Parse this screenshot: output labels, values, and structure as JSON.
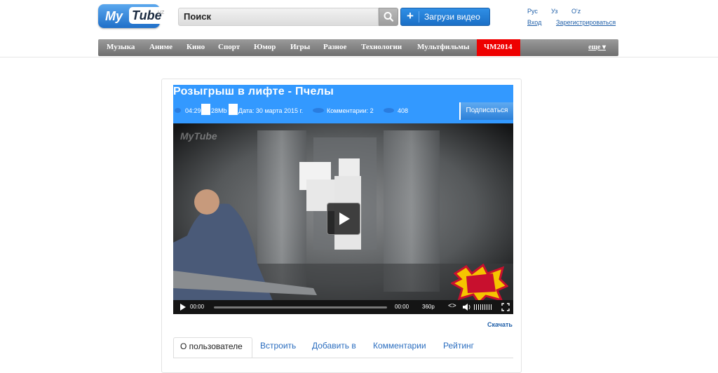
{
  "header": {
    "logo": {
      "my": "My",
      "tube": "Tube",
      "suffix": "UZ"
    },
    "search_value": "Поиск",
    "upload_label": "Загрузи видео",
    "languages": [
      "Рус",
      "Уз",
      "O'z"
    ],
    "login": "Вход",
    "register": "Зарегистрироваться"
  },
  "nav": {
    "items": [
      "Музыка",
      "Аниме",
      "Кино",
      "Спорт",
      "Юмор",
      "Игры",
      "Разное",
      "Технологии",
      "Мультфильмы"
    ],
    "highlight": "ЧМ2014",
    "more": "еще"
  },
  "video": {
    "title": "Розыгрыш в лифте - Пчелы",
    "duration": "04:29",
    "size": "28Mb",
    "date": "Дата: 30 марта 2015 г.",
    "comments": "Комментарии: 2",
    "views": "408",
    "subscribe_label": "Подписаться",
    "watermark": "MyTube",
    "player": {
      "current_time": "00:00",
      "total_time": "00:00",
      "quality": "360p"
    },
    "download_label": "Скачать"
  },
  "tabs": [
    "О пользователе",
    "Встроить",
    "Добавить в",
    "Комментарии",
    "Рейтинг"
  ],
  "colors": {
    "accent": "#3399ff",
    "nav_hot": "#ee0000",
    "link": "#1f5fa8"
  }
}
